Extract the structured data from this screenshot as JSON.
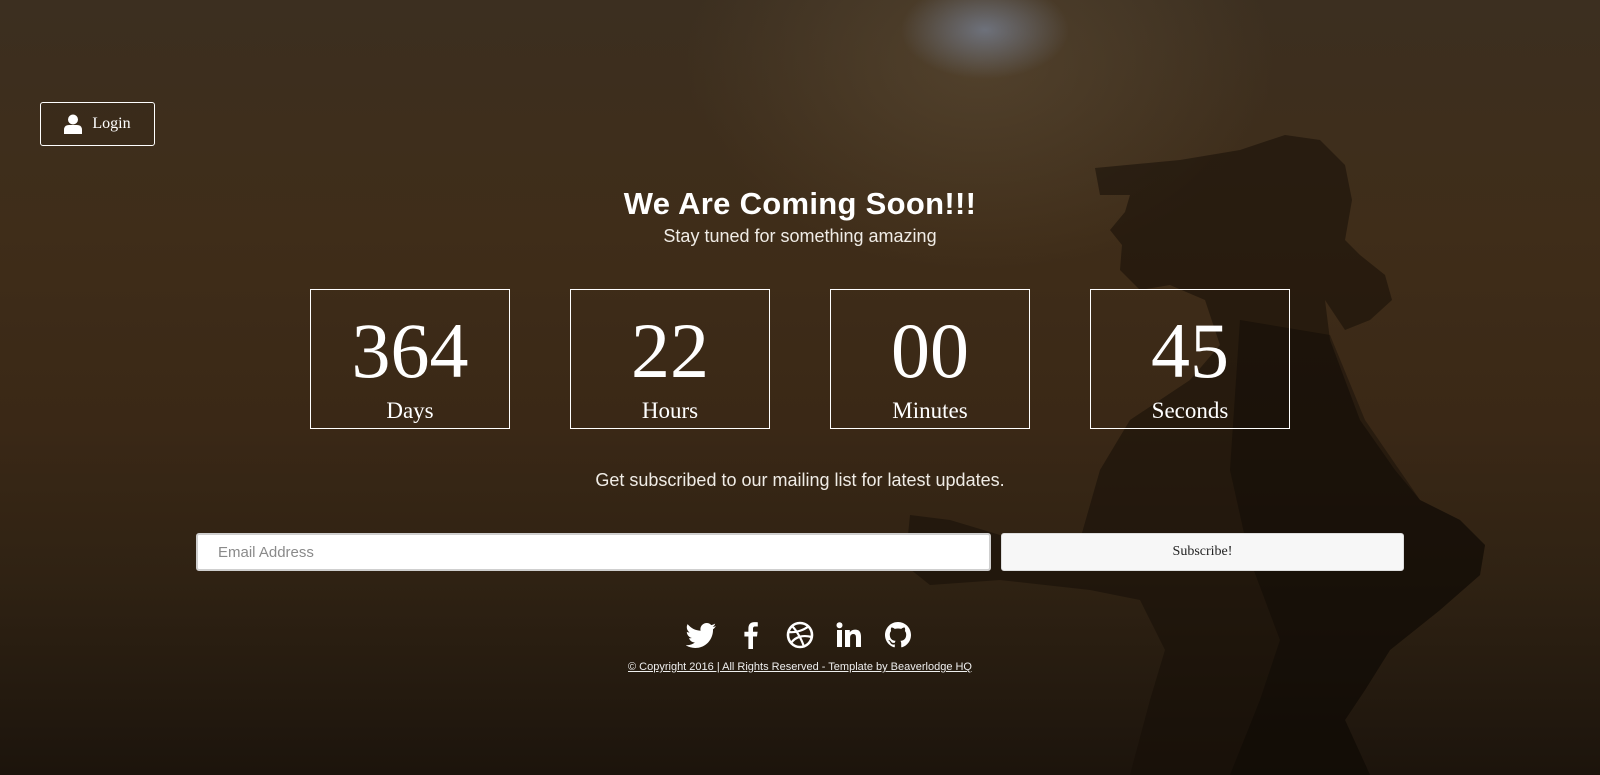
{
  "login": {
    "label": "Login",
    "icon": "user-icon"
  },
  "hero": {
    "title": "We Are Coming Soon!!!",
    "subtitle": "Stay tuned for something amazing"
  },
  "countdown": [
    {
      "value": "364",
      "unit": "Days"
    },
    {
      "value": "22",
      "unit": "Hours"
    },
    {
      "value": "00",
      "unit": "Minutes"
    },
    {
      "value": "45",
      "unit": "Seconds"
    }
  ],
  "mailing": {
    "text": "Get subscribed to our mailing list for latest updates.",
    "email_placeholder": "Email Address",
    "email_value": "",
    "subscribe_label": "Subscribe!"
  },
  "socials": [
    {
      "icon": "twitter-icon"
    },
    {
      "icon": "facebook-icon"
    },
    {
      "icon": "dribbble-icon"
    },
    {
      "icon": "linkedin-icon"
    },
    {
      "icon": "github-icon"
    }
  ],
  "footer": {
    "copyright": "© Copyright 2016 | All Rights Reserved - Template by Beaverlodge HQ"
  },
  "colors": {
    "background": "#3a2816",
    "text": "#ffffff",
    "button_bg": "#f7f7f7"
  }
}
